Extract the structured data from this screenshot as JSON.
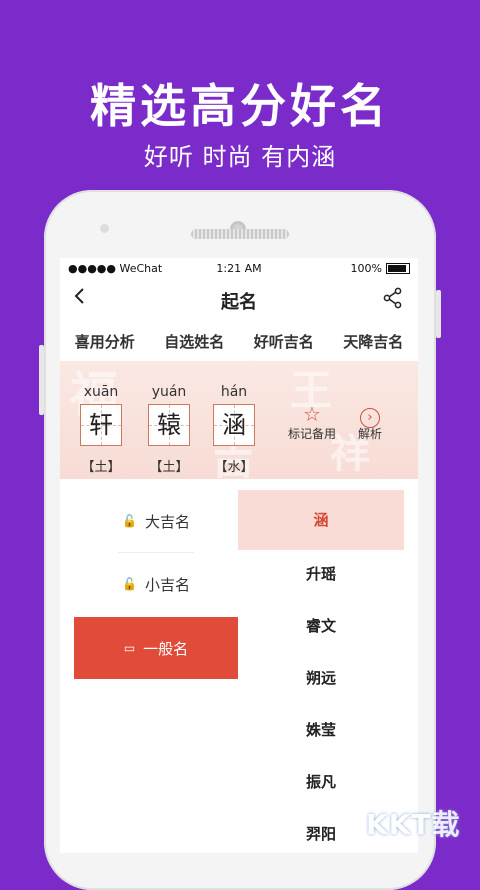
{
  "promo": {
    "title": "精选高分好名",
    "subtitle": "好听 时尚 有内涵"
  },
  "status_bar": {
    "carrier": "●●●●● WeChat",
    "time": "1:21 AM",
    "battery": "100%"
  },
  "nav": {
    "title": "起名"
  },
  "tabs": [
    {
      "label": "喜用分析",
      "active": false
    },
    {
      "label": "自选姓名",
      "active": true
    },
    {
      "label": "好听吉名",
      "active": false
    },
    {
      "label": "天降吉名",
      "active": false
    }
  ],
  "name_chars": [
    {
      "pinyin": "xuān",
      "char": "轩",
      "element": "【土】"
    },
    {
      "pinyin": "yuán",
      "char": "辕",
      "element": "【土】"
    },
    {
      "pinyin": "hán",
      "char": "涵",
      "element": "【水】"
    }
  ],
  "actions": [
    {
      "label": "标记备用",
      "icon": "star-icon"
    },
    {
      "label": "解析",
      "icon": "chevron-right-circle-icon"
    }
  ],
  "categories": [
    {
      "label": "大吉名",
      "icon": "lock-icon",
      "active": false
    },
    {
      "label": "小吉名",
      "icon": "lock-icon",
      "active": false
    },
    {
      "label": "一般名",
      "icon": "note-icon",
      "active": true
    }
  ],
  "names": [
    "涵",
    "升瑶",
    "睿文",
    "朔远",
    "姝莹",
    "振凡",
    "羿阳"
  ],
  "watermark": "KKT载",
  "colors": {
    "background": "#7a2bc9",
    "accent": "#e04b3a",
    "selected_bg": "#f9dcd6"
  }
}
